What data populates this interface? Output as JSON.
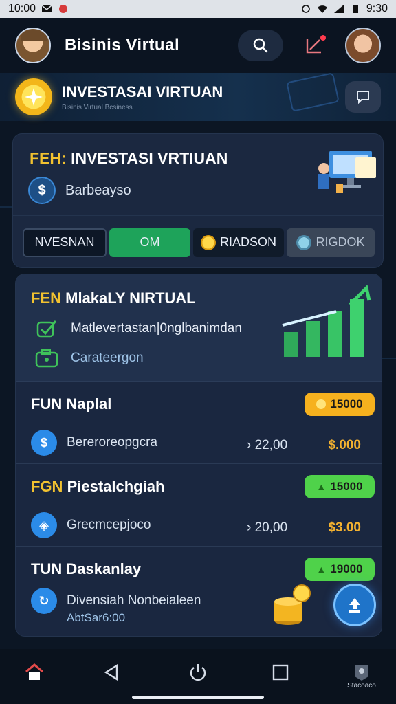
{
  "status_bar": {
    "time": "10:00",
    "battery": "9:30"
  },
  "header": {
    "app_title": "Bisinis Virtual"
  },
  "banner": {
    "title": "INVESTASAI VIRTUAN",
    "subtitle": "Bisinis Virtual Bcsiness"
  },
  "panel_one": {
    "title_prefix": "FEH:",
    "title": "INVESTASI VRTIUAN",
    "subtitle": "Barbeayso",
    "tabs": [
      {
        "label": "NVESNAN"
      },
      {
        "label": "OM"
      },
      {
        "label": "RIADSON"
      },
      {
        "label": "RIGDOK"
      }
    ]
  },
  "feature": {
    "title_prefix": "FEN",
    "title": "MlakaLY NIRTUAL",
    "line1": "Matlevertastan|0nglbanimdan",
    "line2": "Carateergon"
  },
  "items": [
    {
      "title_prefix": "FUN",
      "title": "Naplal",
      "badge": "15000",
      "subtitle": "Bereroreopgcra",
      "amount": "22,00",
      "price": "$.000"
    },
    {
      "title_prefix": "FGN",
      "title": "Piestalchgiah",
      "badge": "15000",
      "subtitle": "Grecmcepjoco",
      "amount": "20,00",
      "price": "$3.00"
    },
    {
      "title_prefix": "TUN",
      "title": "Daskanlay",
      "badge": "19000",
      "subtitle": "Divensiah Nonbeialeen",
      "subtitle2": "AbtSar6:00"
    }
  ],
  "bottom_nav": {
    "last_label": "Stacoaco"
  },
  "colors": {
    "accent_yellow": "#f2c230",
    "accent_green": "#1ea35a",
    "badge_orange": "#f6b11e",
    "badge_green": "#4fd24a",
    "background": "#0c1624"
  }
}
